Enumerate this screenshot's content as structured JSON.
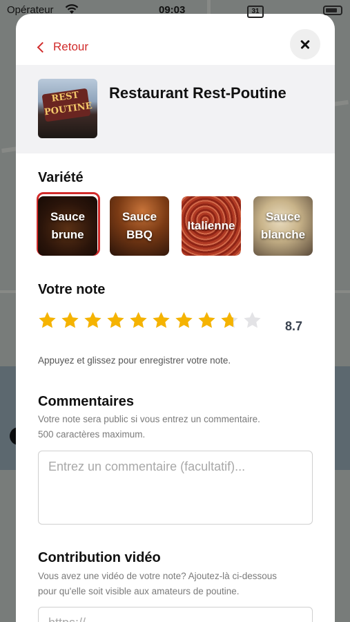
{
  "status_bar": {
    "carrier": "Opérateur",
    "time": "09:03",
    "calendar_day": "31"
  },
  "header": {
    "back_label": "Retour"
  },
  "restaurant": {
    "name": "Restaurant Rest-Poutine",
    "image_sign_text": "REST POUTINE"
  },
  "variety": {
    "title": "Variété",
    "options": [
      {
        "label": "Sauce brune",
        "selected": true
      },
      {
        "label": "Sauce BBQ",
        "selected": false
      },
      {
        "label": "Italienne",
        "selected": false
      },
      {
        "label": "Sauce blanche",
        "selected": false
      }
    ]
  },
  "rating": {
    "title": "Votre note",
    "value": "8.7",
    "value_numeric": 8.7,
    "max_stars": 10,
    "hint": "Appuyez et glissez pour enregistrer votre note.",
    "colors": {
      "filled": "#f5b301",
      "empty": "#e3e3e6"
    }
  },
  "comments": {
    "title": "Commentaires",
    "subtitle_line1": "Votre note sera public si vous entrez un commentaire.",
    "subtitle_line2": "500 caractères maximum.",
    "placeholder": "Entrez un commentaire (facultatif)..."
  },
  "video": {
    "title": "Contribution vidéo",
    "subtitle_line1": "Vous avez une vidéo de votre note? Ajoutez-là ci-dessous",
    "subtitle_line2": "pour qu'elle soit visible aux amateurs de poutine.",
    "placeholder": "https://..."
  },
  "accent_color": "#d12b2b"
}
